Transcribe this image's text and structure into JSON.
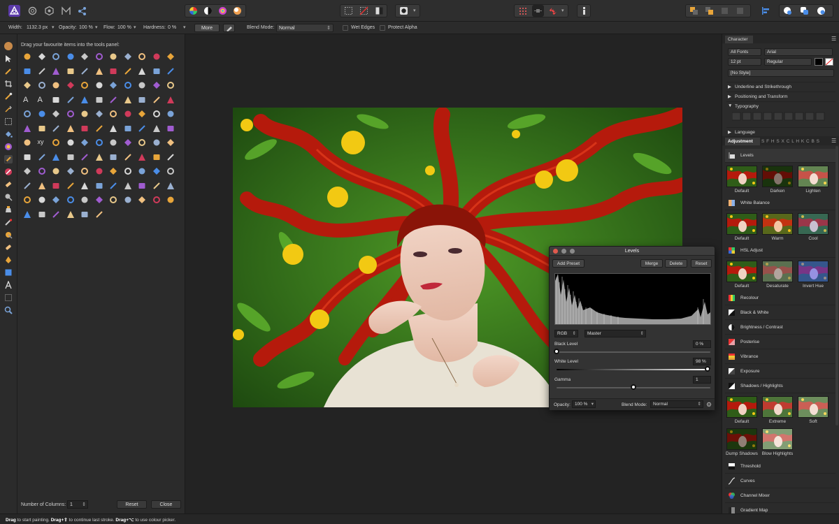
{
  "context_bar": {
    "width_label": "Width:",
    "width_value": "1132.3 px",
    "opacity_label": "Opacity:",
    "opacity_value": "100 %",
    "flow_label": "Flow:",
    "flow_value": "100 %",
    "hardness_label": "Hardness:",
    "hardness_value": "0 %",
    "more_label": "More",
    "blend_label": "Blend Mode:",
    "blend_value": "Normal",
    "wet_edges_label": "Wet Edges",
    "protect_alpha_label": "Protect Alpha"
  },
  "tools_panel": {
    "hint": "Drag your favourite items into the tools panel:",
    "columns_label": "Number of Columns:",
    "columns_value": "1",
    "reset_label": "Reset",
    "close_label": "Close",
    "text_tool_glyph_1": "A",
    "text_tool_glyph_2": "A",
    "xy_glyph": "xy"
  },
  "levels": {
    "title": "Levels",
    "add_preset": "Add Preset",
    "merge": "Merge",
    "delete": "Delete",
    "reset": "Reset",
    "channel": "RGB",
    "mode": "Master",
    "black_level_label": "Black Level",
    "black_level_value": "0 %",
    "black_level_fraction": 0.0,
    "white_level_label": "White Level",
    "white_level_value": "98 %",
    "white_level_fraction": 0.98,
    "gamma_label": "Gamma",
    "gamma_value": "1",
    "gamma_fraction": 0.5,
    "opacity_label": "Opacity:",
    "opacity_value": "100 %",
    "blend_label": "Blend Mode:",
    "blend_value": "Normal"
  },
  "character": {
    "tab": "Character",
    "font_collection": "All Fonts",
    "font_family": "Arial",
    "font_size": "12 pt",
    "font_style": "Regular",
    "style": "[No Style]",
    "sections": [
      "Underline and Strikethrough",
      "Positioning and Transform",
      "Typography",
      "Language"
    ]
  },
  "adjustment": {
    "tab": "Adjustment",
    "letters": "S F H S X C L H K C B S",
    "levels": "Levels",
    "levels_presets": [
      "Default",
      "Darken",
      "Lighten"
    ],
    "white_balance": "White Balance",
    "wb_presets": [
      "Default",
      "Warm",
      "Cool"
    ],
    "hsl": "HSL Adjust",
    "hsl_presets": [
      "Default",
      "Desaturate",
      "Invert Hue"
    ],
    "recolour": "Recolour",
    "black_white": "Black & White",
    "brightness": "Brightness / Contrast",
    "posterise": "Posterise",
    "vibrance": "Vibrance",
    "exposure": "Exposure",
    "shadows": "Shadows / Highlights",
    "shadows_presets": [
      "Default",
      "Extreme",
      "Soft",
      "Dump Shadows",
      "Blow Highlights"
    ],
    "threshold": "Threshold",
    "curves": "Curves",
    "channel_mixer": "Channel Mixer",
    "gradient_map": "Gradient Map"
  },
  "status": {
    "a_bold": "Drag",
    "a_text": " to start painting. ",
    "b_bold": "Drag+⇧",
    "b_text": " to continue last stroke. ",
    "c_bold": "Drag+⌥",
    "c_text": " to use colour picker."
  },
  "colors": {
    "accent": "#8a5cf6",
    "hair_red": "#b51a0c",
    "grass_green": "#3f8a1f",
    "dandelion": "#f2c913"
  }
}
